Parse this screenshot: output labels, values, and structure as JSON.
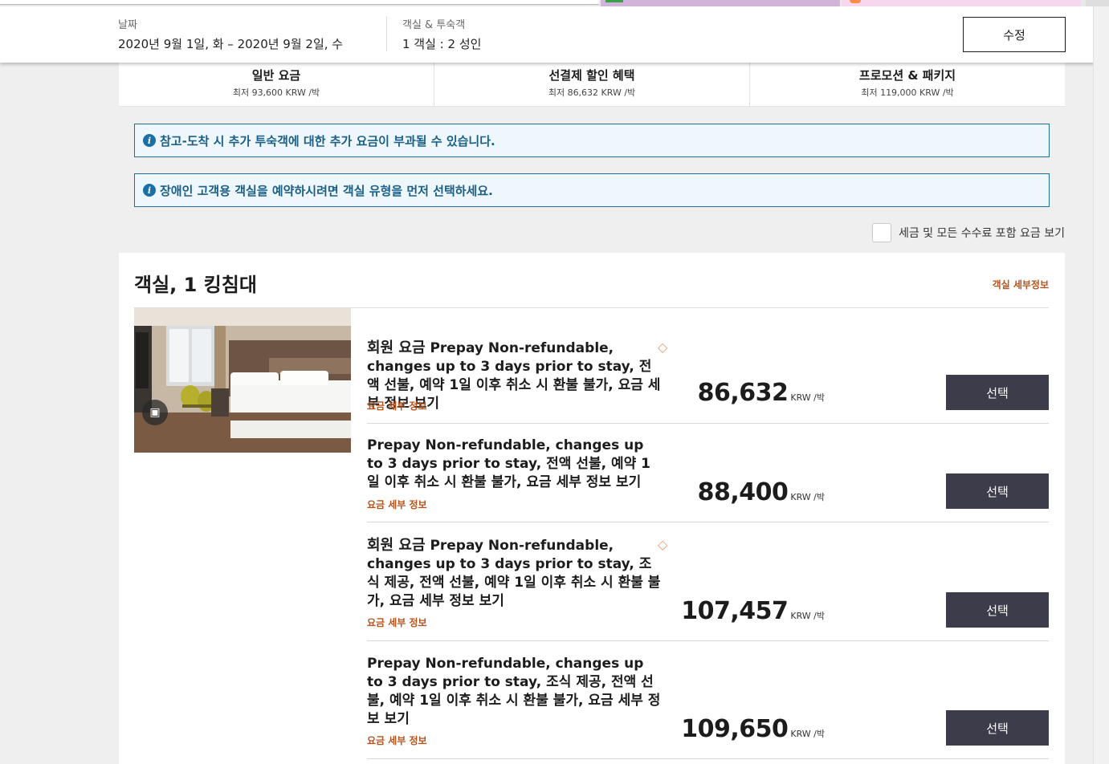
{
  "header": {
    "date_label": "날짜",
    "date_value": "2020년 9월 1일, 화 – 2020년 9월 2일, 수",
    "guests_label": "객실 & 투숙객",
    "guests_value": "1 객실 : 2 성인",
    "edit_label": "수정"
  },
  "rate_tabs": [
    {
      "name": "일반 요금",
      "from": "최저 93,600 KRW /박"
    },
    {
      "name": "선결제 할인 혜택",
      "from": "최저 86,632 KRW /박"
    },
    {
      "name": "프로모션 & 패키지",
      "from": "최저 119,000 KRW /박"
    }
  ],
  "notices": [
    "참고-도착 시 추가 투숙객에 대한 추가 요금이 부과될 수 있습니다.",
    "장애인 고객용 객실을 예약하시려면 객실 유형을 먼저 선택하세요."
  ],
  "tax_toggle_label": "세금 및 모든 수수료 포함 요금 보기",
  "room": {
    "title": "객실, 1 킹침대",
    "details_link": "객실 세부정보",
    "rates": [
      {
        "member_prefix": "회원 요금",
        "description": "Prepay Non-refundable, changes up to 3 days prior to stay, 전액 선불, 예약 1일 이후 취소 시 환불 불가, 요금 세부 정보 보기",
        "details_link": "요금 세부 정보",
        "price": "86,632",
        "unit": "KRW /박",
        "button": "선택"
      },
      {
        "member_prefix": "",
        "description": "Prepay Non-refundable, changes up to 3 days prior to stay, 전액 선불, 예약 1일 이후 취소 시 환불 불가, 요금 세부 정보 보기",
        "details_link": "요금 세부 정보",
        "price": "88,400",
        "unit": "KRW /박",
        "button": "선택"
      },
      {
        "member_prefix": "회원 요금",
        "description": "Prepay Non-refundable, changes up to 3 days prior to stay, 조식 제공, 전액 선불, 예약 1일 이후 취소 시 환불 불가, 요금 세부 정보 보기",
        "details_link": "요금 세부 정보",
        "price": "107,457",
        "unit": "KRW /박",
        "button": "선택"
      },
      {
        "member_prefix": "",
        "description": "Prepay Non-refundable, changes up to 3 days prior to stay, 조식 제공, 전액 선불, 예약 1일 이후 취소 시 환불 불가, 요금 세부 정보 보기",
        "details_link": "요금 세부 정보",
        "price": "109,650",
        "unit": "KRW /박",
        "button": "선택"
      }
    ]
  },
  "colors": {
    "accent_link": "#b3541e",
    "button_bg": "#3d3c4a",
    "notice_border": "#1f6f9c"
  }
}
